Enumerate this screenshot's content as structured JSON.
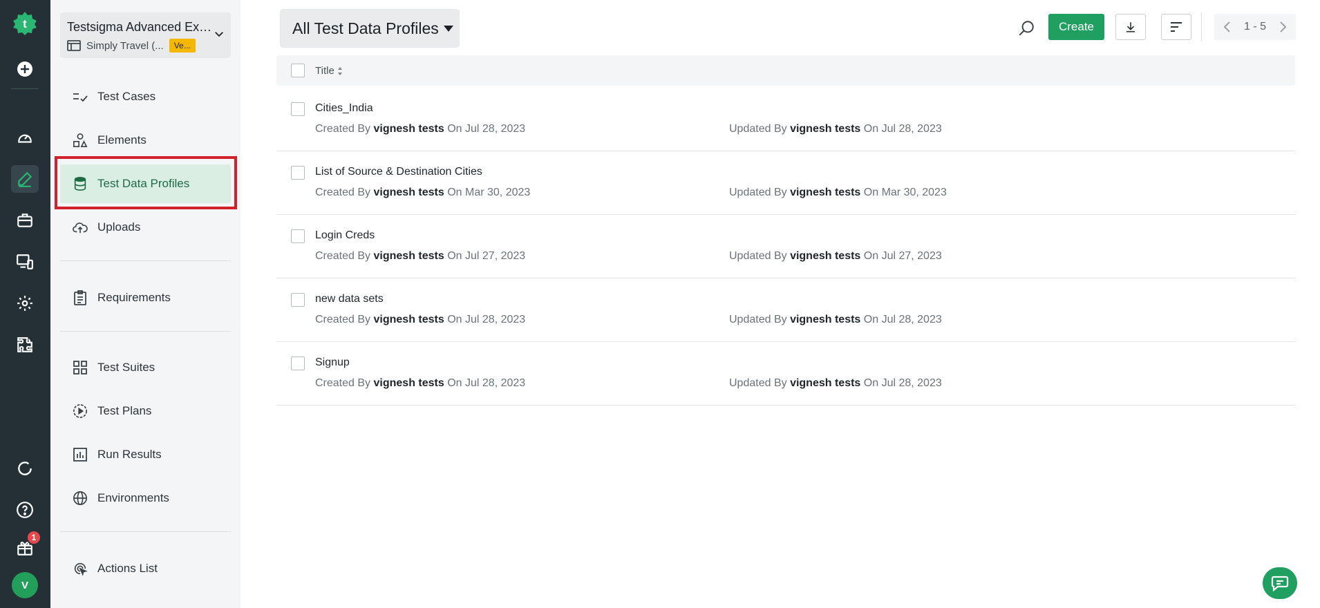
{
  "rail": {
    "notification_count": "1",
    "avatar_initial": "V",
    "icons": [
      "testsigma-logo-icon",
      "add-icon",
      "dashboard-icon",
      "edit-icon",
      "briefcase-icon",
      "devices-icon",
      "settings-icon",
      "addons-icon",
      "refresh-icon",
      "help-icon",
      "gift-icon"
    ]
  },
  "project": {
    "name": "Testsigma Advanced Exa...",
    "app": "Simply Travel (...",
    "version": "Ve..."
  },
  "sidebar": {
    "items": [
      {
        "label": "Test Cases",
        "icon": "test-cases-icon"
      },
      {
        "label": "Elements",
        "icon": "elements-icon"
      },
      {
        "label": "Test Data Profiles",
        "icon": "database-icon",
        "active": true
      },
      {
        "label": "Uploads",
        "icon": "cloud-upload-icon"
      },
      {
        "label": "Requirements",
        "icon": "clipboard-icon"
      },
      {
        "label": "Test Suites",
        "icon": "grid-icon"
      },
      {
        "label": "Test Plans",
        "icon": "play-circle-icon"
      },
      {
        "label": "Run Results",
        "icon": "bar-chart-icon"
      },
      {
        "label": "Environments",
        "icon": "globe-icon"
      },
      {
        "label": "Actions List",
        "icon": "cursor-target-icon"
      }
    ]
  },
  "header": {
    "view_label": "All Test Data Profiles",
    "create_label": "Create",
    "pager_text": "1 - 5"
  },
  "table": {
    "column_title": "Title",
    "created_by_label": "Created By",
    "updated_by_label": "Updated By",
    "rows": [
      {
        "title": "Cities_India",
        "created_by": "vignesh tests",
        "created_on": "On Jul 28, 2023",
        "updated_by": "vignesh tests",
        "updated_on": "On Jul 28, 2023"
      },
      {
        "title": "List of Source & Destination Cities",
        "created_by": "vignesh tests",
        "created_on": "On Mar 30, 2023",
        "updated_by": "vignesh tests",
        "updated_on": "On Mar 30, 2023"
      },
      {
        "title": "Login Creds",
        "created_by": "vignesh tests",
        "created_on": "On Jul 27, 2023",
        "updated_by": "vignesh tests",
        "updated_on": "On Jul 27, 2023"
      },
      {
        "title": "new data sets",
        "created_by": "vignesh tests",
        "created_on": "On Jul 28, 2023",
        "updated_by": "vignesh tests",
        "updated_on": "On Jul 28, 2023"
      },
      {
        "title": "Signup",
        "created_by": "vignesh tests",
        "created_on": "On Jul 28, 2023",
        "updated_by": "vignesh tests",
        "updated_on": "On Jul 28, 2023"
      }
    ]
  },
  "colors": {
    "accent": "#20a060",
    "rail_bg": "#243036",
    "active_nav_bg": "#dbeee4",
    "highlight": "#d3212c",
    "version_tag": "#f5b800"
  }
}
